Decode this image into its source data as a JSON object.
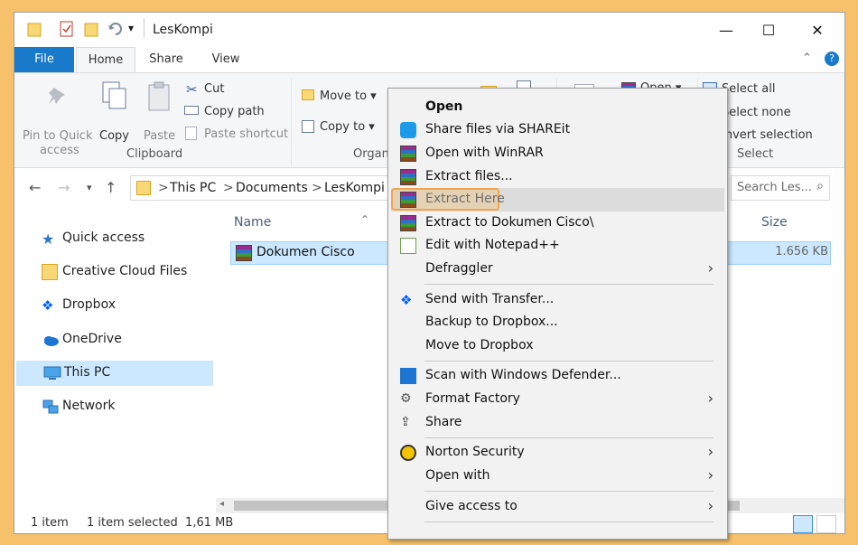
{
  "window": {
    "title": "LesKompi",
    "controls": {
      "minimize": "—",
      "maximize": "☐",
      "close": "✕"
    }
  },
  "ribbon": {
    "tabs": [
      "File",
      "Home",
      "Share",
      "View"
    ],
    "clipboard": {
      "pin_label_1": "Pin to Quick",
      "pin_label_2": "access",
      "copy": "Copy",
      "paste": "Paste",
      "cut": "Cut",
      "copy_path": "Copy path",
      "paste_shortcut": "Paste shortcut",
      "group": "Clipboard"
    },
    "organize": {
      "move_to": "Move to ▾",
      "copy_to": "Copy to ▾",
      "group_partial": "Organ"
    },
    "open_partial": "Open ▾",
    "select": {
      "select_all": "Select all",
      "select_none": "Select none",
      "invert": "Invert selection",
      "group": "Select"
    }
  },
  "address": {
    "crumbs": [
      "This PC",
      "Documents",
      "LesKompi"
    ],
    "separator": ">",
    "search_placeholder": "Search Les..."
  },
  "nav_pane": {
    "items": [
      {
        "label": "Quick access",
        "icon": "star-icon"
      },
      {
        "label": "Creative Cloud Files",
        "icon": "creative-cloud-icon"
      },
      {
        "label": "Dropbox",
        "icon": "dropbox-icon"
      },
      {
        "label": "OneDrive",
        "icon": "onedrive-icon"
      },
      {
        "label": "This PC",
        "icon": "computer-icon",
        "selected": true
      },
      {
        "label": "Network",
        "icon": "network-icon"
      }
    ]
  },
  "content": {
    "columns": {
      "name": "Name",
      "size": "Size"
    },
    "file": {
      "name": "Dokumen Cisco",
      "size": "1.656 KB"
    }
  },
  "status": {
    "count": "1 item",
    "selected": "1 item selected  1,61 MB"
  },
  "context_menu": {
    "items": [
      {
        "label": "Open",
        "bold": true
      },
      {
        "label": "Share files via SHAREit"
      },
      {
        "label": "Open with WinRAR"
      },
      {
        "label": "Extract files..."
      },
      {
        "label": "Extract Here",
        "highlighted": true
      },
      {
        "label": "Extract to Dokumen Cisco\\"
      },
      {
        "label": "Edit with Notepad++"
      },
      {
        "label": "Defraggler",
        "submenu": true
      },
      {
        "label": "Send with Transfer..."
      },
      {
        "label": "Backup to Dropbox..."
      },
      {
        "label": "Move to Dropbox"
      },
      {
        "label": "Scan with Windows Defender..."
      },
      {
        "label": "Format Factory",
        "submenu": true
      },
      {
        "label": "Share"
      },
      {
        "label": "Norton Security",
        "submenu": true
      },
      {
        "label": "Open with",
        "submenu": true
      },
      {
        "label": "Give access to",
        "submenu": true
      }
    ]
  },
  "colors": {
    "accent": "#1979ca",
    "selection": "#cce8ff",
    "highlight_frame": "#f0a64e",
    "background": "#f6c16a"
  }
}
